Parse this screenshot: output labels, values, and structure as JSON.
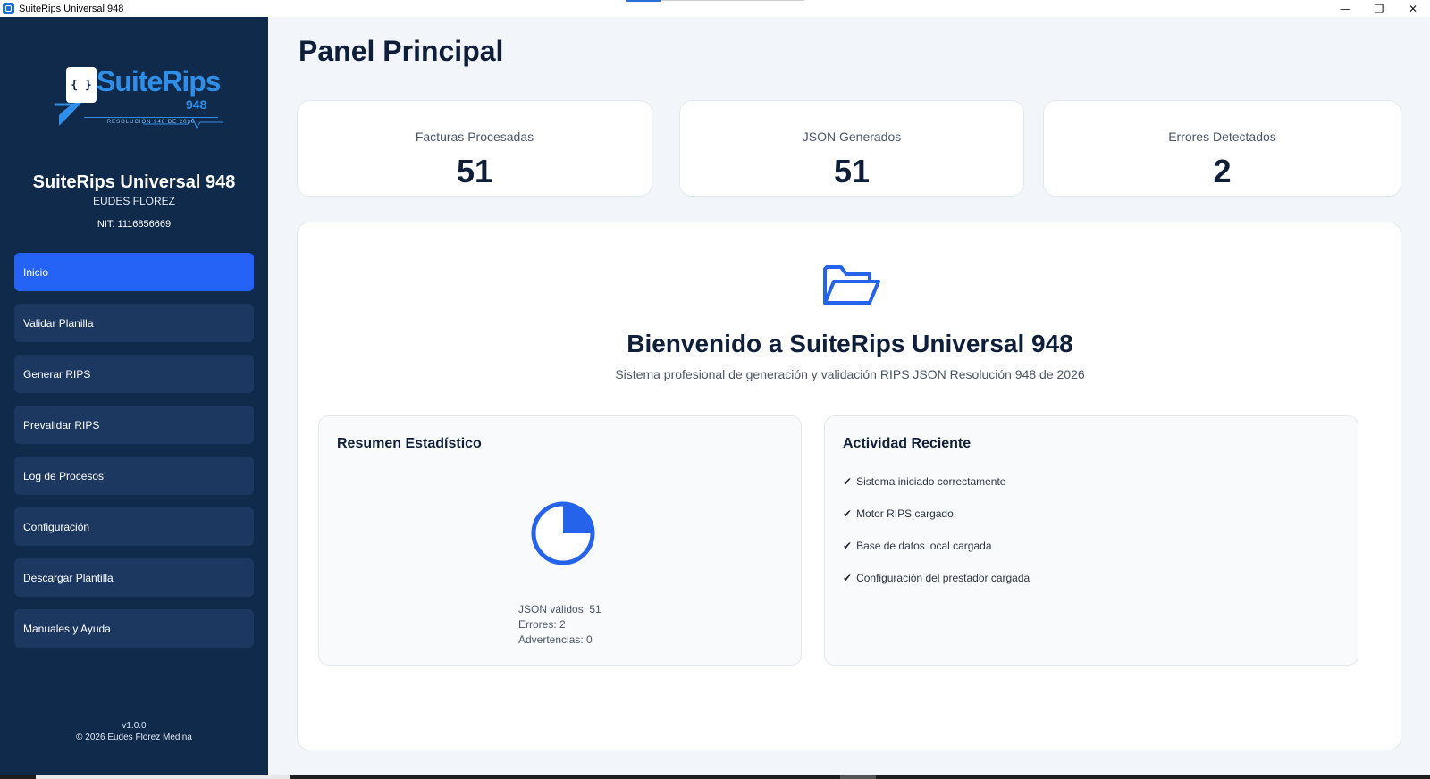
{
  "window": {
    "title": "SuiteRips Universal 948",
    "minimize_glyph": "—",
    "maximize_glyph": "❐",
    "close_glyph": "✕"
  },
  "sidebar": {
    "logo": {
      "brand": "SuiteRips",
      "number": "948",
      "icon_glyph": "{ }",
      "resolution": "RESOLUCIÓN 948 DE 2026"
    },
    "app_name": "SuiteRips Universal 948",
    "user_name": "EUDES FLOREZ",
    "nit": "NIT: 1116856669",
    "nav": [
      {
        "label": "Inicio",
        "active": true
      },
      {
        "label": "Validar Planilla",
        "active": false
      },
      {
        "label": "Generar RIPS",
        "active": false
      },
      {
        "label": "Prevalidar RIPS",
        "active": false
      },
      {
        "label": "Log de Procesos",
        "active": false
      },
      {
        "label": "Configuración",
        "active": false
      },
      {
        "label": "Descargar Plantilla",
        "active": false
      },
      {
        "label": "Manuales y Ayuda",
        "active": false
      }
    ],
    "version": "v1.0.0",
    "copyright": "© 2026 Eudes Florez Medina"
  },
  "main": {
    "title": "Panel Principal",
    "stats": [
      {
        "label": "Facturas Procesadas",
        "value": "51"
      },
      {
        "label": "JSON Generados",
        "value": "51"
      },
      {
        "label": "Errores Detectados",
        "value": "2"
      }
    ],
    "welcome": {
      "icon": "folder-open-icon",
      "title": "Bienvenido a SuiteRips Universal 948",
      "subtitle": "Sistema profesional de generación y validación RIPS JSON Resolución 948 de 2026"
    },
    "summary": {
      "title": "Resumen Estadístico",
      "lines": [
        "JSON válidos: 51",
        "Errores: 2",
        "Advertencias: 0"
      ],
      "pie_filled_fraction": 0.25
    },
    "activity": {
      "title": "Actividad Reciente",
      "check_glyph": "✔",
      "items": [
        "Sistema iniciado correctamente",
        "Motor RIPS cargado",
        "Base de datos local cargada",
        "Configuración del prestador cargada"
      ]
    }
  },
  "colors": {
    "sidebar_bg": "#0f2a4a",
    "nav_item": "#1c3860",
    "nav_active": "#2563f6",
    "accent": "#2563eb",
    "main_bg": "#f2f6fa"
  }
}
